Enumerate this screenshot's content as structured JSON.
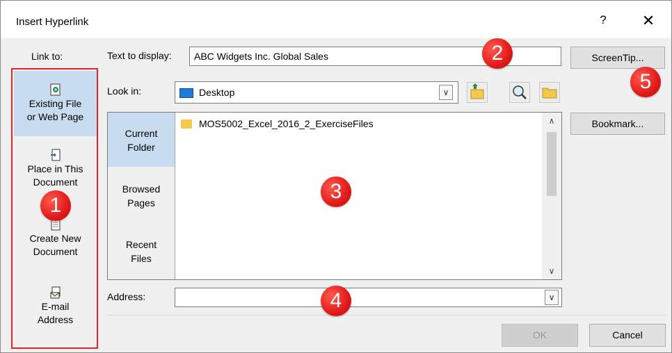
{
  "dialog": {
    "title": "Insert Hyperlink",
    "help": "?",
    "close": "✕"
  },
  "link_to": {
    "label": "Link to:",
    "items": [
      {
        "line1": "Existing File",
        "line2": "or Web Page",
        "icon": "existing-file-icon",
        "selected": true
      },
      {
        "line1": "Place in This",
        "line2": "Document",
        "icon": "place-in-document-icon",
        "selected": false
      },
      {
        "line1": "Create New",
        "line2": "Document",
        "icon": "new-document-icon",
        "selected": false
      },
      {
        "line1": "E-mail",
        "line2": "Address",
        "icon": "email-icon",
        "selected": false
      }
    ]
  },
  "text_to_display": {
    "label": "Text to display:",
    "value": "ABC Widgets Inc. Global Sales"
  },
  "screentip_button": "ScreenTip...",
  "look_in": {
    "label": "Look in:",
    "value": "Desktop"
  },
  "bookmark_button": "Bookmark...",
  "browse_tabs": [
    {
      "line1": "Current",
      "line2": "Folder",
      "selected": true
    },
    {
      "line1": "Browsed",
      "line2": "Pages",
      "selected": false
    },
    {
      "line1": "Recent",
      "line2": "Files",
      "selected": false
    }
  ],
  "files": [
    {
      "name": "MOS5002_Excel_2016_2_ExerciseFiles",
      "icon": "folder-icon"
    }
  ],
  "address": {
    "label": "Address:",
    "value": ""
  },
  "ok_button": "OK",
  "cancel_button": "Cancel",
  "callouts": [
    "1",
    "2",
    "3",
    "4",
    "5"
  ],
  "colors": {
    "callout": "#e11a1a",
    "selection": "#c7dcef",
    "highlight_border": "#e0242b"
  }
}
